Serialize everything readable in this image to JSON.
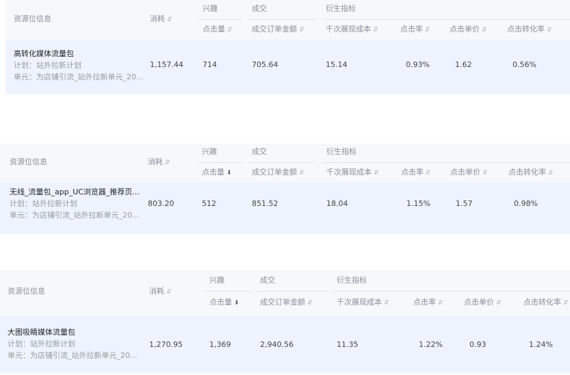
{
  "header_labels": {
    "resource_info": "资源位信息",
    "consume": "消耗",
    "interest_group": "兴趣",
    "clicks": "点击量",
    "deal_group": "成交",
    "order_amount": "成交订单金额",
    "derived_group": "衍生指标",
    "cpm": "千次展现成本",
    "ctr": "点击率",
    "cpc": "点击单价",
    "cvr": "点击转化率"
  },
  "sort_icons": {
    "idle": "⇵",
    "desc": "⬇"
  },
  "tables": [
    {
      "name": "高转化媒体流量包",
      "plan": "计划：站外拉新计划",
      "unit": "单元：为店铺引流_站外拉新单元_20...",
      "consume": "1,157.44",
      "clicks": "714",
      "order_amount": "705.64",
      "cpm": "15.14",
      "ctr": "0.93%",
      "cpc": "1.62",
      "cvr": "0.56%",
      "clicks_sorted": false
    },
    {
      "name": "无线_流量包_app_UC浏览器_推荐页...",
      "plan": "计划：站外拉新计划",
      "unit": "单元：为店铺引流_站外拉新单元_20...",
      "consume": "803.20",
      "clicks": "512",
      "order_amount": "851.52",
      "cpm": "18.04",
      "ctr": "1.15%",
      "cpc": "1.57",
      "cvr": "0.98%",
      "clicks_sorted": true
    },
    {
      "name": "大图吸睛媒体流量包",
      "plan": "计划：站外拉新计划",
      "unit": "单元：为店铺引流_站外拉新单元_20...",
      "consume": "1,270.95",
      "clicks": "1,369",
      "order_amount": "2,940.56",
      "cpm": "11.35",
      "ctr": "1.22%",
      "cpc": "0.93",
      "cvr": "1.24%",
      "clicks_sorted": true
    }
  ]
}
